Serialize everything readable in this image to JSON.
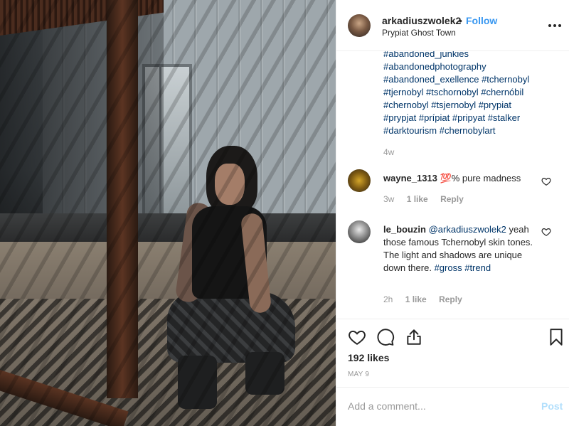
{
  "post": {
    "username": "arkadiuszwolek2",
    "separator": "•",
    "follow_label": "Follow",
    "location": "Prypiat Ghost Town",
    "more_icon": "more-options-icon"
  },
  "caption": {
    "tags_lines": [
      "#abandoned_junkies",
      "#abandonedphotography",
      "#abandoned_exellence #tchernobyl",
      "#tjernobyl #tschornobyl #chernóbil",
      "#chernobyl #tsjernobyl #prypiat",
      "#prypjat #prípiat #pripyat #stalker",
      "#darktourism #chernobylart"
    ],
    "time": "4w"
  },
  "comments": [
    {
      "username": "wayne_1313",
      "text": "💯% pure madness",
      "time": "3w",
      "likes": "1 like",
      "reply_label": "Reply"
    },
    {
      "username": "le_bouzin",
      "mention": "@arkadiuszwolek2",
      "text": "yeah those famous Tchernobyl skin tones. The light and shadows are unique down there.",
      "tag1": "#gross",
      "tag2": "#trend",
      "time": "2h",
      "likes": "1 like",
      "reply_label": "Reply"
    }
  ],
  "actions": {
    "likes_count": "192 likes",
    "date": "MAY 9"
  },
  "add_comment": {
    "placeholder": "Add a comment...",
    "post_label": "Post"
  },
  "colors": {
    "link_blue": "#3897f0",
    "tag_blue": "#003569",
    "muted": "#999999",
    "post_disabled": "#b2dffc"
  }
}
